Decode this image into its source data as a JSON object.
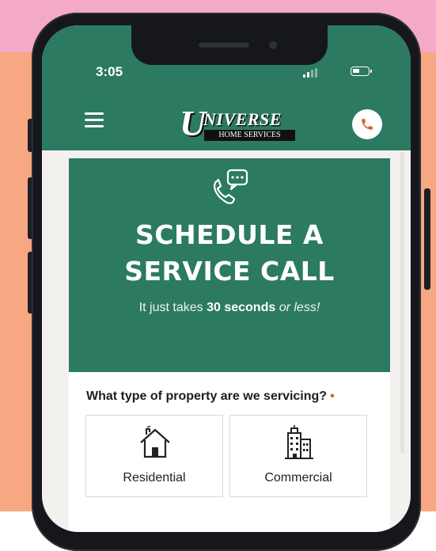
{
  "status_bar": {
    "time": "3:05"
  },
  "header": {
    "logo": {
      "initial": "U",
      "name": "NIVERSE",
      "subtitle": "HOME SERVICES"
    },
    "menu_icon": "hamburger-menu-icon",
    "call_icon": "phone-icon"
  },
  "hero": {
    "icon": "phone-chat-icon",
    "title_line1": "SCHEDULE A",
    "title_line2": "SERVICE CALL",
    "subtitle_prefix": "It just takes ",
    "subtitle_bold": "30 seconds",
    "subtitle_italic": "or less!"
  },
  "form": {
    "question": "What type of property are we servicing?",
    "required_marker": "•",
    "options": [
      {
        "label": "Residential",
        "icon": "house-icon"
      },
      {
        "label": "Commercial",
        "icon": "building-icon"
      }
    ]
  },
  "colors": {
    "brand_green": "#2c7a62",
    "accent_orange": "#e2572b",
    "background_peach": "#f7a882",
    "background_pink": "#f4a9c8"
  }
}
